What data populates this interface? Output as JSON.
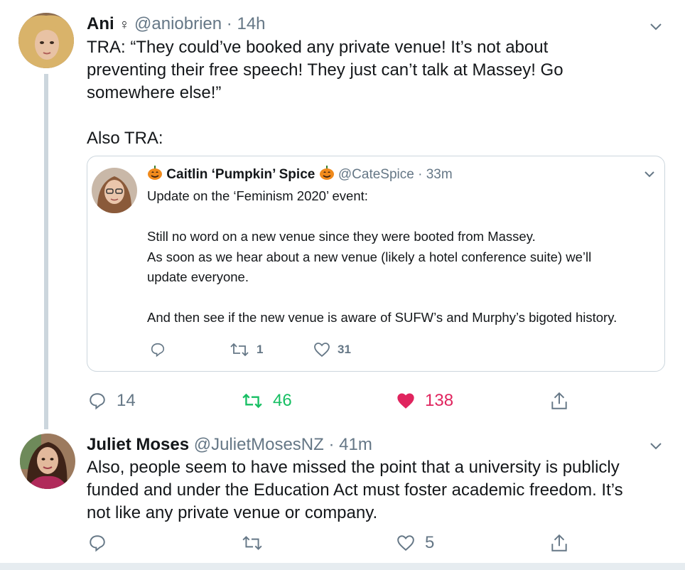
{
  "tweet1": {
    "name": "Ani",
    "name_symbol": "♀",
    "handle": "@aniobrien",
    "separator": "·",
    "time": "14h",
    "text": "TRA: “They could’ve booked any private venue! It’s not about\npreventing their free speech! They just can’t talk at Massey! Go\nsomewhere else!”\n\nAlso TRA:",
    "replies": "14",
    "retweets": "46",
    "likes": "138"
  },
  "quoted": {
    "name": "Caitlin ‘Pumpkin’ Spice",
    "handle": "@CateSpice",
    "separator": "·",
    "time": "33m",
    "text": "Update on the ‘Feminism 2020’ event:\n\nStill no word on a new venue since they were booted from Massey.\nAs soon as we hear about a new venue (likely a hotel conference suite) we’ll\nupdate everyone.\n\nAnd then see if the new venue is aware of SUFW’s and Murphy’s bigoted history.",
    "retweets": "1",
    "likes": "31"
  },
  "tweet2": {
    "name": "Juliet Moses",
    "handle": "@JulietMosesNZ",
    "separator": "·",
    "time": "41m",
    "text": "Also, people seem to have missed the point that a university is publicly\nfunded and under the Education Act must foster academic freedom. It’s\nnot like any private venue or company.",
    "likes": "5"
  },
  "colors": {
    "retweet_active": "#17bf63",
    "like_active": "#e0245e",
    "muted": "#657786",
    "border": "#ccd6dd"
  }
}
